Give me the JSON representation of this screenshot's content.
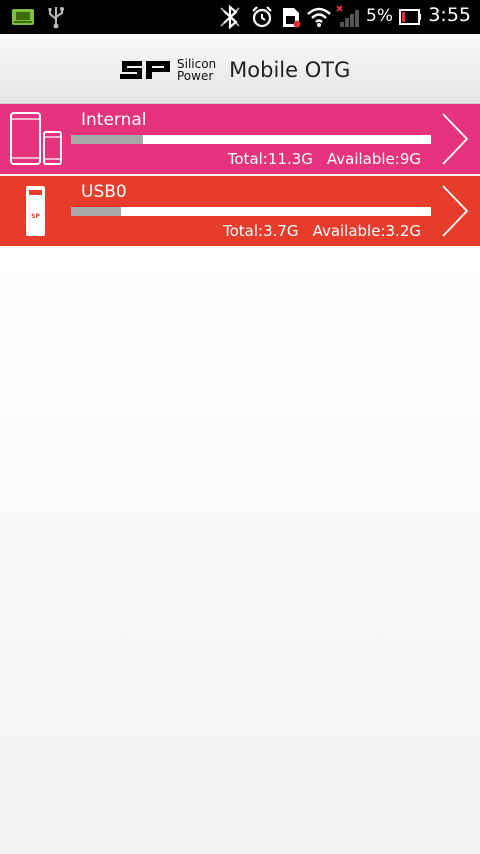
{
  "status_bar": {
    "battery_percent": "5%",
    "time": "3:55",
    "icons": [
      "sd-card-icon",
      "usb-icon",
      "bluetooth-icon",
      "alarm-icon",
      "sim-icon",
      "wifi-icon",
      "signal-icon",
      "battery-icon"
    ]
  },
  "header": {
    "brand_line1": "Silicon",
    "brand_line2": "Power",
    "product": "Mobile OTG"
  },
  "storage": [
    {
      "name": "Internal",
      "total_label": "Total:11.3G",
      "available_label": "Available:9G",
      "used_fraction": 0.2,
      "color": "#e5337d"
    },
    {
      "name": "USB0",
      "total_label": "Total:3.7G",
      "available_label": "Available:3.2G",
      "used_fraction": 0.14,
      "color": "#e63c2c"
    }
  ],
  "colors": {
    "usage_fill": "#a8a8a8",
    "usage_track": "#ffffff"
  }
}
